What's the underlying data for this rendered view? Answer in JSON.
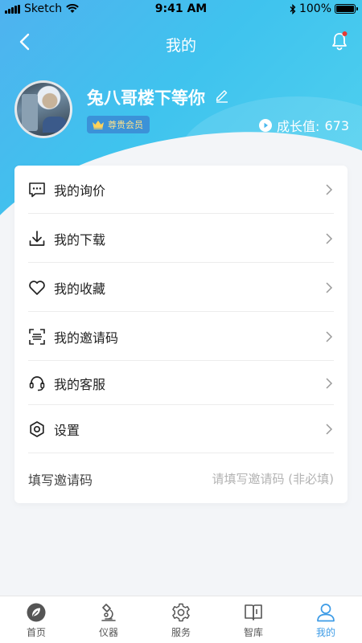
{
  "status_bar": {
    "carrier": "Sketch",
    "time": "9:41 AM",
    "battery": "100%",
    "battery_level": 1.0
  },
  "nav": {
    "title": "我的",
    "has_notification": true
  },
  "profile": {
    "username": "兔八哥楼下等你",
    "badge": "尊贵会员",
    "growth_label": "成长值:",
    "growth_value": "673"
  },
  "menu": {
    "items": [
      {
        "label": "我的询价",
        "icon": "message-icon"
      },
      {
        "label": "我的下载",
        "icon": "download-icon"
      },
      {
        "label": "我的收藏",
        "icon": "heart-icon"
      },
      {
        "label": "我的邀请码",
        "icon": "scan-code-icon"
      },
      {
        "label": "我的客服",
        "icon": "headset-icon"
      },
      {
        "label": "设置",
        "icon": "settings-icon"
      }
    ],
    "invite": {
      "label": "填写邀请码",
      "placeholder": "请填写邀请码 (非必填)",
      "value": ""
    }
  },
  "tabbar": {
    "tabs": [
      {
        "label": "首页",
        "icon": "home-leaf-icon",
        "active": false
      },
      {
        "label": "仪器",
        "icon": "microscope-icon",
        "active": false
      },
      {
        "label": "服务",
        "icon": "gear-icon",
        "active": false
      },
      {
        "label": "智库",
        "icon": "book-icon",
        "active": false
      },
      {
        "label": "我的",
        "icon": "user-icon",
        "active": true
      }
    ]
  },
  "colors": {
    "header_start": "#4fb2ef",
    "header_end": "#52d2ef",
    "accent": "#3c9be6",
    "badge_bg": "#3b92d8",
    "badge_text": "#ffe28a",
    "notification_dot": "#e53935"
  }
}
